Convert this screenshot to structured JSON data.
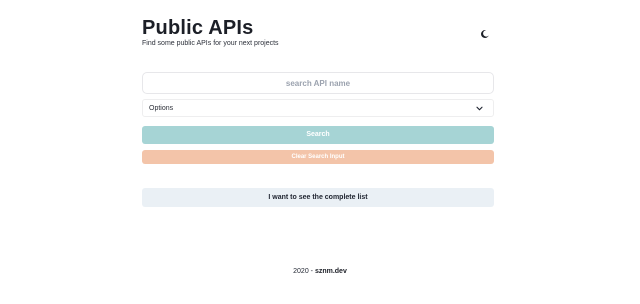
{
  "header": {
    "title": "Public APIs",
    "subtitle": "Find some public APIs for your next projects",
    "theme_toggle_icon": "moon-icon"
  },
  "search": {
    "placeholder": "search API name",
    "value": ""
  },
  "filter": {
    "selected": "Options",
    "dropdown_icon": "chevron-down-icon"
  },
  "actions": {
    "search_label": "Search",
    "clear_label": "Clear Search Input",
    "complete_list_label": "I want to see the complete list"
  },
  "footer": {
    "year_text": "2020 - ",
    "link_text": "sznm.dev"
  },
  "colors": {
    "search_button": "#a6d4d5",
    "clear_button": "#f3c4a9",
    "complete_list_button": "#eaf0f5"
  }
}
